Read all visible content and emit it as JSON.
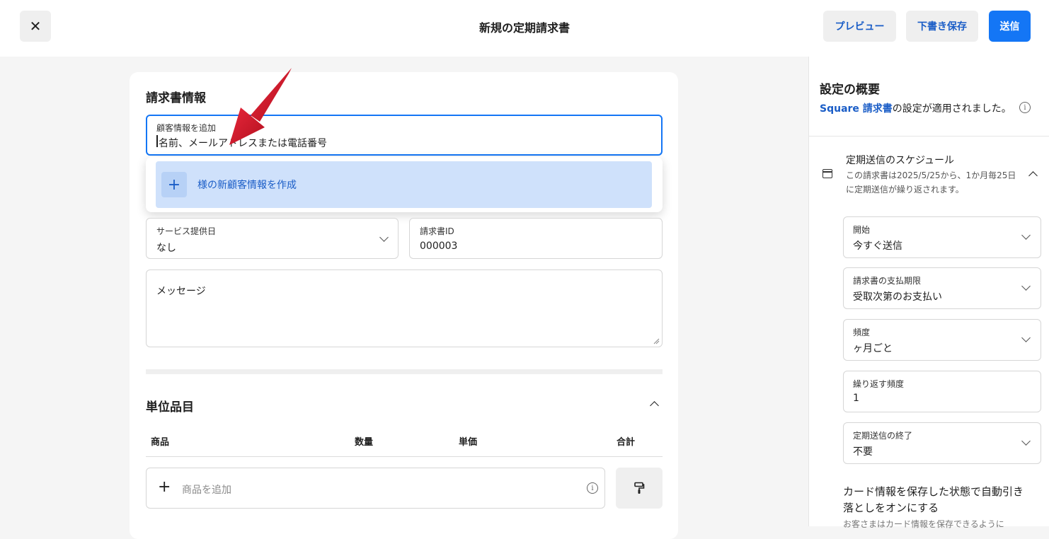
{
  "header": {
    "close_icon": "close-icon",
    "title": "新規の定期請求書",
    "preview_label": "プレビュー",
    "draft_label": "下書き保存",
    "send_label": "送信"
  },
  "invoice_info": {
    "section_title": "請求書情報",
    "customer": {
      "label": "顧客情報を追加",
      "placeholder": "名前、メールアドレスまたは電話番号"
    },
    "dropdown": {
      "create_label": "様の新顧客情報を作成"
    },
    "service_date": {
      "label": "サービス提供日",
      "value": "なし"
    },
    "invoice_id": {
      "label": "請求書ID",
      "value": "000003"
    },
    "message": {
      "placeholder": "メッセージ"
    }
  },
  "line_items": {
    "section_title": "単位品目",
    "columns": [
      "商品",
      "数量",
      "単価",
      "合計"
    ],
    "add_item_placeholder": "商品を追加"
  },
  "summary": {
    "title": "設定の概要",
    "applied_link": "Square 請求書",
    "applied_text": "の設定が適用されました。",
    "schedule_title": "定期送信のスケジュール",
    "schedule_desc": "この請求書は2025/5/25から、1か月毎25日に定期送信が繰り返されます。",
    "fields": [
      {
        "label": "開始",
        "value": "今すぐ送信",
        "dropdown": true
      },
      {
        "label": "請求書の支払期限",
        "value": "受取次第のお支払い",
        "dropdown": true
      },
      {
        "label": "頻度",
        "value": "ヶ月ごと",
        "dropdown": true
      },
      {
        "label": "繰り返す頻度",
        "value": "1",
        "dropdown": false
      },
      {
        "label": "定期送信の終了",
        "value": "不要",
        "dropdown": true
      }
    ],
    "card_toggle_text": "カード情報を保存した状態で自動引き落としをオンにする",
    "card_toggle_sub": "お客さまはカード情報を保存できるように"
  },
  "colors": {
    "accent": "#1476f5",
    "link": "#1a5dc7",
    "highlight": "#cfe1fb",
    "annotation_arrow": "#d0162a"
  }
}
